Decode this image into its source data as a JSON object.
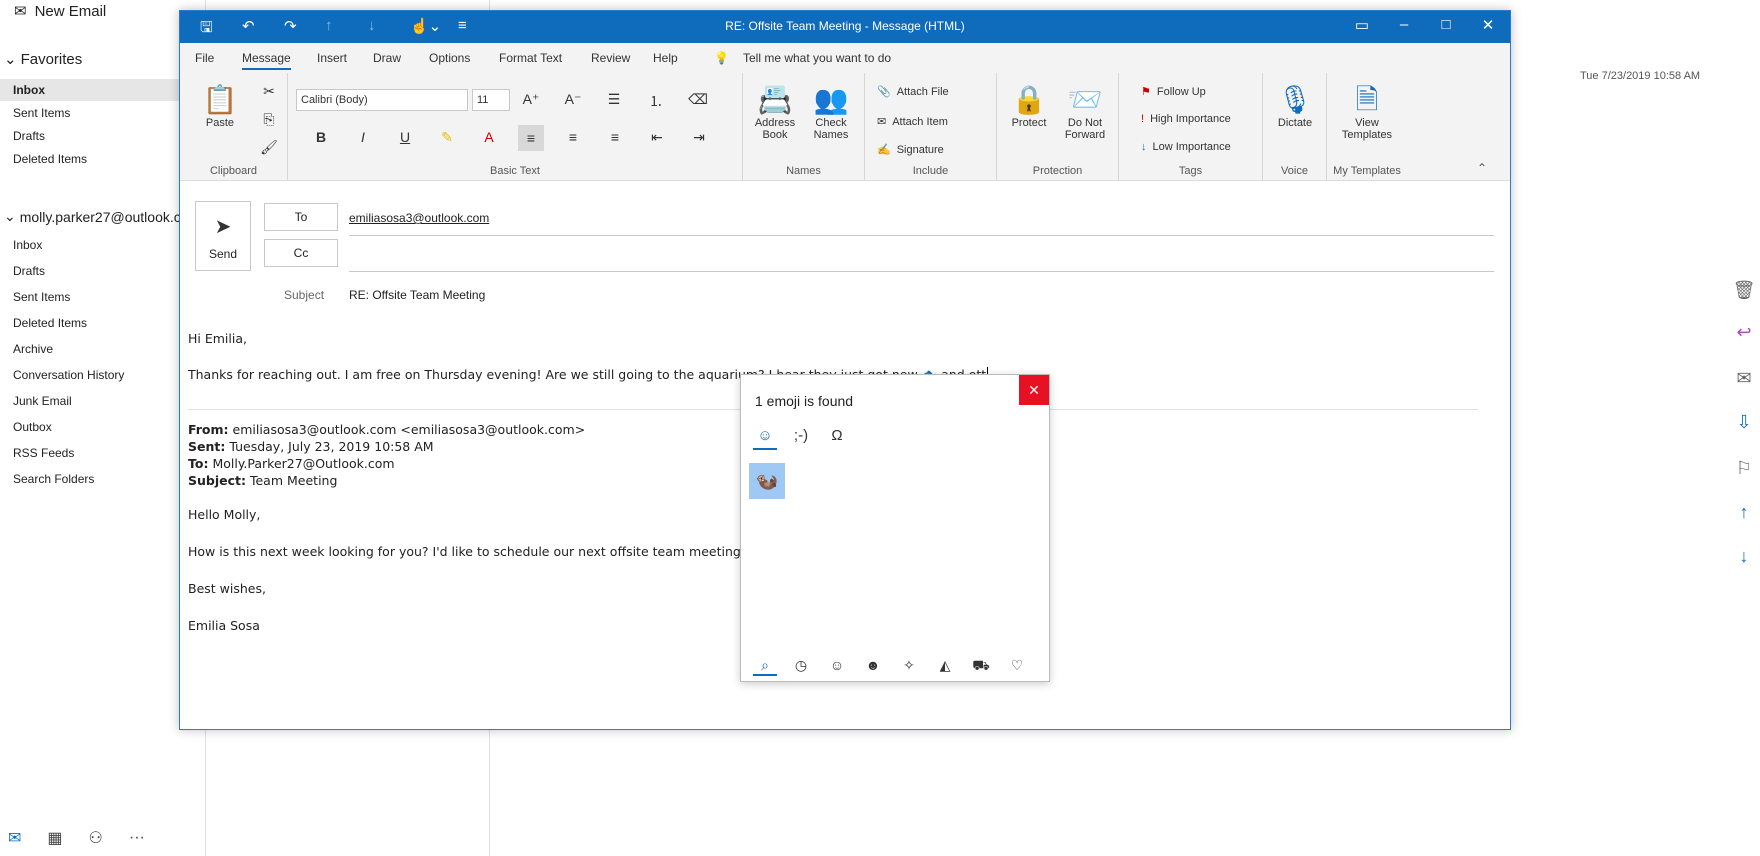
{
  "nav": {
    "new_email": "New Email",
    "favorites_label": "Favorites",
    "favorites": [
      "Inbox",
      "Sent Items",
      "Drafts",
      "Deleted Items"
    ],
    "account_label": "molly.parker27@outlook.c...",
    "folders": [
      "Inbox",
      "Drafts",
      "Sent Items",
      "Deleted Items",
      "Archive",
      "Conversation History",
      "Junk Email",
      "Outbox",
      "RSS Feeds",
      "Search Folders"
    ]
  },
  "reading": {
    "datetime": "Tue 7/23/2019 10:58 AM"
  },
  "window": {
    "title": "RE: Offsite Team Meeting  -  Message (HTML)",
    "menus": [
      "File",
      "Message",
      "Insert",
      "Draw",
      "Options",
      "Format Text",
      "Review",
      "Help"
    ],
    "tell_me": "Tell me what you want to do"
  },
  "ribbon": {
    "clipboard": {
      "label": "Clipboard",
      "paste": "Paste"
    },
    "basic_text": {
      "label": "Basic Text",
      "font": "Calibri (Body)",
      "size": "11"
    },
    "names": {
      "label": "Names",
      "address_book_1": "Address",
      "address_book_2": "Book",
      "check_names_1": "Check",
      "check_names_2": "Names"
    },
    "include": {
      "label": "Include",
      "attach_file": "Attach File",
      "attach_item": "Attach Item",
      "signature": "Signature"
    },
    "protection": {
      "label": "Protection",
      "protect": "Protect",
      "dnf_1": "Do Not",
      "dnf_2": "Forward"
    },
    "tags": {
      "label": "Tags",
      "follow_up": "Follow Up",
      "high": "High Importance",
      "low": "Low Importance"
    },
    "voice": {
      "label": "Voice",
      "dictate": "Dictate"
    },
    "templates": {
      "label": "My Templates",
      "view_1": "View",
      "view_2": "Templates"
    }
  },
  "compose": {
    "send": "Send",
    "to_label": "To",
    "to_value": "emiliasosa3@outlook.com",
    "cc_label": "Cc",
    "subject_label": "Subject",
    "subject_value": "RE: Offsite Team Meeting",
    "greeting": "Hi Emilia,",
    "body_text": "Thanks for reaching out.  I am free on Thursday evening!  Are we still going to the aquarium? I hear they just got new",
    "body_emoji": "🐟",
    "body_tail": "and ott",
    "quoted": {
      "from_label": "From:",
      "from_value": "emiliasosa3@outlook.com <emiliasosa3@outlook.com>",
      "sent_label": "Sent:",
      "sent_value": "Tuesday, July 23, 2019 10:58 AM",
      "to_label": "To:",
      "to_value": "Molly.Parker27@Outlook.com",
      "subject_label": "Subject:",
      "subject_value": "Team Meeting",
      "greeting": "Hello Molly,",
      "body": "How is this next week looking for you?  I'd like to schedule our next offsite team meeting!",
      "closing": "Best wishes,",
      "signature": "Emilia Sosa"
    }
  },
  "emoji_panel": {
    "header": "1 emoji is found",
    "result": "🦦",
    "close": "✕"
  }
}
